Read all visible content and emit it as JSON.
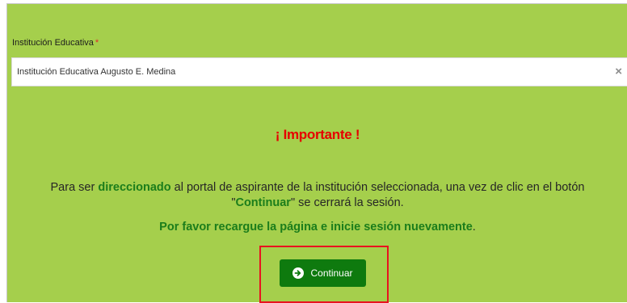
{
  "form": {
    "label": "Institución Educativa",
    "required_marker": "*",
    "selected_value": "Institución Educativa Augusto E. Medina",
    "clear_symbol": "×"
  },
  "notice": {
    "heading": "¡ Importante !",
    "message_part1": "Para ser ",
    "message_highlight1": "direccionado",
    "message_part2": " al portal de aspirante de la institución seleccionada, una vez de clic en el botón",
    "message_quote_open": "\"",
    "message_highlight2": "Continuar",
    "message_part3": "\" se cerrará la sesión.",
    "reload_text": "Por favor recargue la página e inicie sesión nuevamente",
    "reload_end": "."
  },
  "actions": {
    "continue_label": "Continuar",
    "continue_icon": "arrow-circle-right-icon"
  },
  "colors": {
    "panel_background": "#a5cf4c",
    "heading_red": "#e60000",
    "accent_green": "#1b7d1b",
    "button_green": "#0e7a0e",
    "highlight_border": "#e8131f"
  }
}
